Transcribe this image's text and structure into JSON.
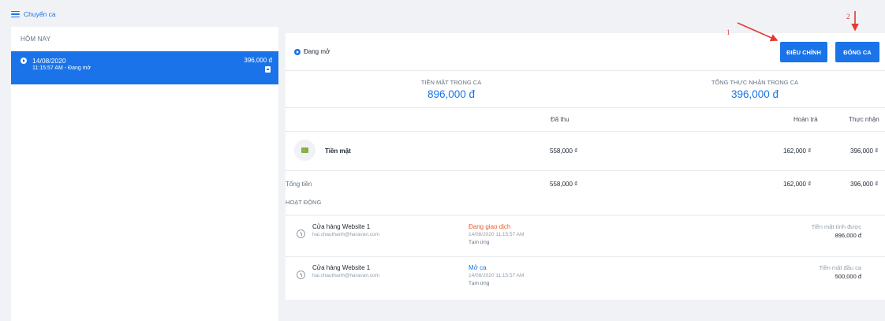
{
  "header": {
    "title": "Chuyển ca"
  },
  "sidebar": {
    "section_title": "HÔM NAY",
    "shift": {
      "date": "14/08/2020",
      "sub": "11:15:57 AM - Đang mở",
      "amount": "396,000 đ"
    }
  },
  "panel": {
    "status": "Đang mở",
    "buttons": {
      "adjust": "ĐIỀU CHỈNH",
      "close": "ĐÓNG CA"
    },
    "summary": [
      {
        "label": "TIỀN MẶT TRONG CA",
        "value": "896,000 đ"
      },
      {
        "label": "TỔNG THỰC NHẬN TRONG CA",
        "value": "396,000 đ"
      }
    ],
    "table": {
      "headers": {
        "collected": "Đã thu",
        "refund": "Hoàn trả",
        "net": "Thực nhận"
      },
      "rows": [
        {
          "method": "Tiền mặt",
          "collected": "558,000 ₫",
          "refund": "162,000 ₫",
          "net": "396,000 ₫"
        }
      ],
      "total": {
        "label": "Tổng tiền",
        "collected": "558,000 ₫",
        "refund": "162,000 ₫",
        "net": "396,000 ₫"
      }
    }
  },
  "activity": {
    "title": "HOẠT ĐỘNG",
    "items": [
      {
        "store": "Cửa hàng Website 1",
        "email": "hai.chauthanh@haravan.com",
        "type": "Đang giao dịch",
        "type_color": "#ef5b2f",
        "time": "14/08/2020 11:15:57 AM",
        "note": "Tạm ứng",
        "label": "Tiền mặt tính được",
        "value": "896,000 đ"
      },
      {
        "store": "Cửa hàng Website 1",
        "email": "hai.chauthanh@haravan.com",
        "type": "Mở ca",
        "type_color": "#1a73e8",
        "time": "14/08/2020 11:15:57 AM",
        "note": "Tạm ứng",
        "label": "Tiền mặt đầu ca",
        "value": "500,000 đ"
      }
    ]
  },
  "annotations": {
    "one": "1",
    "two": "2"
  },
  "colors": {
    "accent": "#1a73e8",
    "warning": "#ef5b2f",
    "annotation": "#e53935"
  }
}
